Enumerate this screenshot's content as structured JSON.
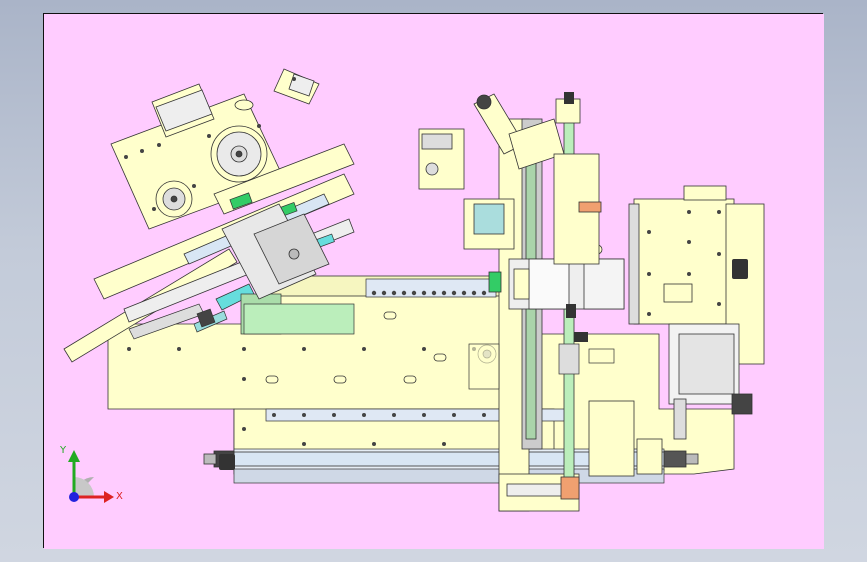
{
  "viewport": {
    "background": "#ffccff",
    "border_color": "#111111"
  },
  "colors": {
    "cream_part": "#ffffcc",
    "outline": "#333333",
    "green_part": "#99dd99",
    "bright_green": "#33cc66",
    "cyan_part": "#66dddd",
    "grey_part": "#cfcfcf",
    "light_grey": "#e6e6e6",
    "orange_part": "#f0a070",
    "bolt": "#444444"
  },
  "triad": {
    "y_label": "Y",
    "x_label": "X",
    "y_color": "#22aa22",
    "x_color": "#dd2222",
    "origin_color": "#2222dd"
  }
}
